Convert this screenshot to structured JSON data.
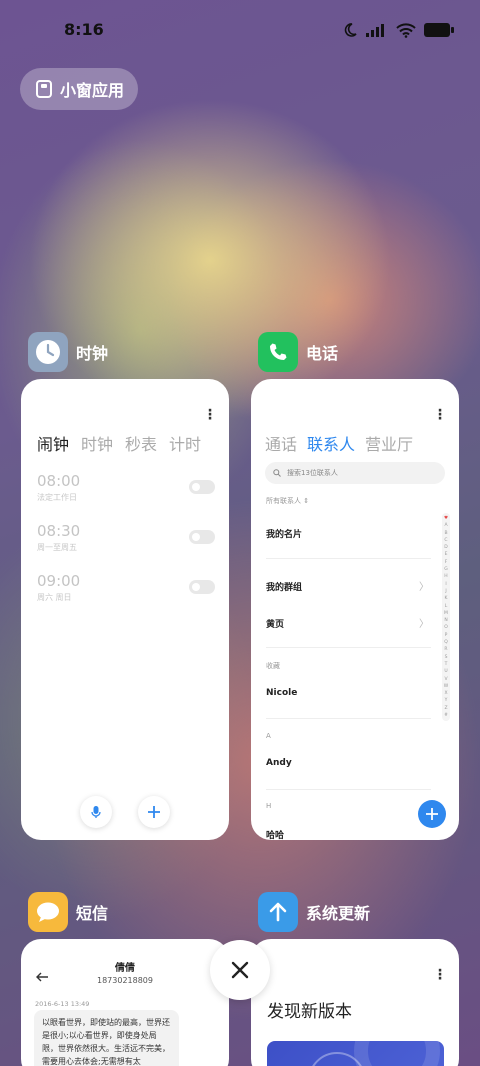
{
  "status_bar": {
    "time": "8:16"
  },
  "chip": {
    "label": "小窗应用"
  },
  "apps": {
    "clock": {
      "title": "时钟",
      "tabs": [
        "闹钟",
        "时钟",
        "秒表",
        "计时"
      ],
      "alarms": [
        {
          "time": "08:00",
          "label": "法定工作日"
        },
        {
          "time": "08:30",
          "label": "周一至周五"
        },
        {
          "time": "09:00",
          "label": "周六 周日"
        }
      ]
    },
    "phone": {
      "title": "电话",
      "tabs": [
        "通话",
        "联系人",
        "营业厅"
      ],
      "search_placeholder": "搜索13位联系人",
      "all_contacts": "所有联系人",
      "my_card": "我的名片",
      "my_groups": "我的群组",
      "yellow_pages": "黄页",
      "favorites_label": "收藏",
      "contacts": [
        {
          "section": "",
          "name": "Nicole"
        },
        {
          "section": "A",
          "name": "Andy"
        },
        {
          "section": "H",
          "name": "哈哈"
        }
      ],
      "alphabet": [
        "♥",
        "A",
        "B",
        "C",
        "D",
        "E",
        "F",
        "G",
        "H",
        "I",
        "J",
        "K",
        "L",
        "M",
        "N",
        "O",
        "P",
        "Q",
        "R",
        "S",
        "T",
        "U",
        "V",
        "W",
        "X",
        "Y",
        "Z",
        "#"
      ]
    },
    "messages": {
      "title": "短信",
      "contact_name": "倩倩",
      "contact_number": "18730218809",
      "date": "2016-6-13 13:49",
      "message": "以眼看世界，即使站的最高，世界还是很小;以心看世界，即使身处局限，世界依然很大。生活远不完美，需要用心去体会;无需想有太"
    },
    "update": {
      "title": "系统更新",
      "heading": "发现新版本"
    }
  },
  "colors": {
    "clock_icon_bg": "#8fa4bf",
    "phone_icon_bg": "#22c15e",
    "messages_icon_bg": "#f7b93c",
    "update_icon_bg": "#3a9be8",
    "accent_blue": "#2f88ee"
  }
}
